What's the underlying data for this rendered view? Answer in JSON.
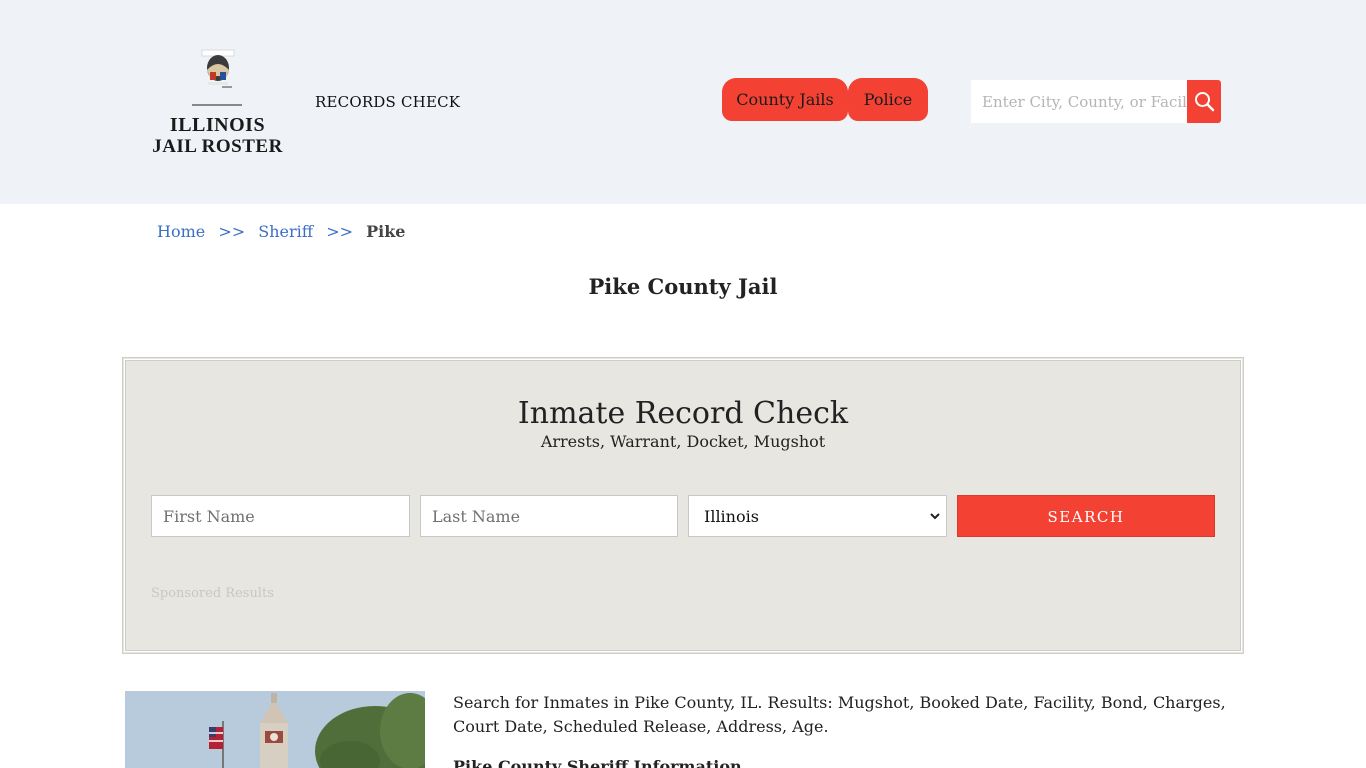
{
  "logo": {
    "line1": "ILLINOIS",
    "line2": "JAIL ROSTER"
  },
  "nav": {
    "records_check": "RECORDS CHECK",
    "county_jails": "County Jails",
    "police": "Police"
  },
  "header_search": {
    "placeholder": "Enter City, County, or Facility"
  },
  "breadcrumb": {
    "home": "Home",
    "sep": ">>",
    "sheriff": "Sheriff",
    "current": "Pike"
  },
  "page_title": "Pike County Jail",
  "record_check": {
    "title": "Inmate Record Check",
    "subtitle": "Arrests, Warrant, Docket, Mugshot",
    "first_name_placeholder": "First Name",
    "last_name_placeholder": "Last Name",
    "state_selected": "Illinois",
    "search_label": "SEARCH",
    "sponsored": "Sponsored Results"
  },
  "content": {
    "intro": "Search for Inmates in Pike County, IL. Results: Mugshot, Booked Date, Facility, Bond, Charges, Court Date, Scheduled Release, Address, Age.",
    "subhead": "Pike County Sheriff Information"
  },
  "colors": {
    "accent": "#f34234",
    "header_bg": "#eff3f8",
    "panel_bg": "#e8e6e1",
    "link": "#3a6fc5"
  }
}
